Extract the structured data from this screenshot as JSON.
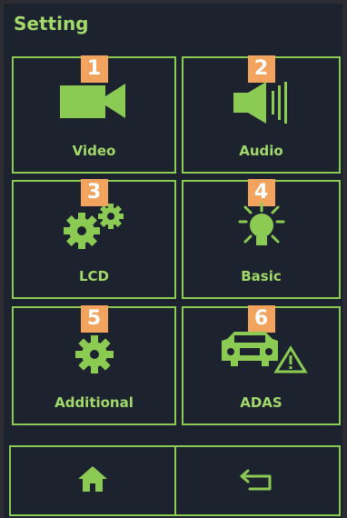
{
  "header": {
    "title": "Setting"
  },
  "tiles": [
    {
      "number": "1",
      "label": "Video",
      "icon": "video-camera-icon"
    },
    {
      "number": "2",
      "label": "Audio",
      "icon": "speaker-icon"
    },
    {
      "number": "3",
      "label": "LCD",
      "icon": "gears-icon"
    },
    {
      "number": "4",
      "label": "Basic",
      "icon": "light-bulb-icon"
    },
    {
      "number": "5",
      "label": "Additional",
      "icon": "gear-icon"
    },
    {
      "number": "6",
      "label": "ADAS",
      "icon": "car-warning-icon"
    }
  ],
  "bottom_bar": {
    "home_icon": "home-icon",
    "back_icon": "back-arrow-icon"
  },
  "colors": {
    "accent": "#8ccb53",
    "background": "#1c232f",
    "badge": "#f2a35d"
  }
}
